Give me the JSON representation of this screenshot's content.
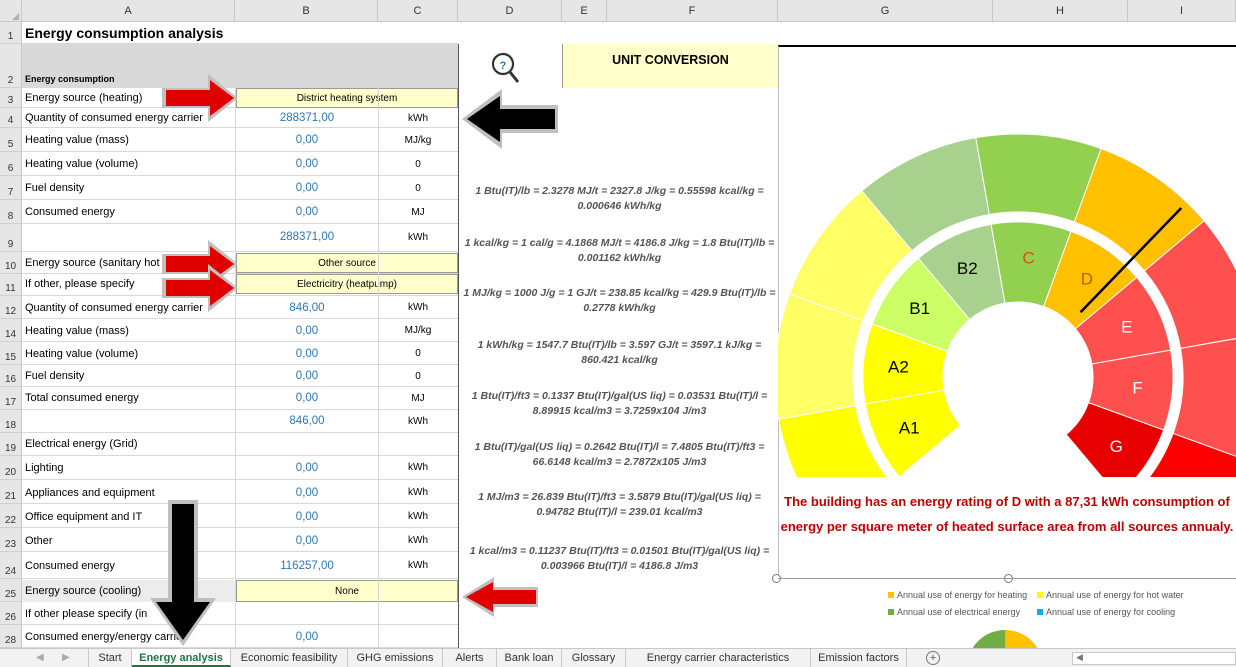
{
  "columns": [
    "A",
    "B",
    "C",
    "D",
    "E",
    "F",
    "G",
    "H",
    "I"
  ],
  "title": "Energy consumption analysis",
  "rows": {
    "r2": "Energy consumption",
    "r3": "Energy source (heating)",
    "r4": "Quantity of consumed energy carrier",
    "r5": "Heating value (mass)",
    "r6": "Heating value (volume)",
    "r7": "Fuel density",
    "r8": "Consumed energy",
    "r10": "Energy source (sanitary hot water)",
    "r11": "If other, please specify",
    "r12": "Quantity of consumed energy carrier",
    "r14": "Heating value (mass)",
    "r15": "Heating value (volume)",
    "r16": "Fuel density",
    "r17": "Total consumed energy",
    "r19": "Electrical energy (Grid)",
    "r20": "Lighting",
    "r21": "Appliances and equipment",
    "r22": "Office equipment and IT",
    "r23": "Other",
    "r24": "Consumed energy",
    "r25": "Energy source (cooling)",
    "r26": "If other please specify (in ",
    "r26b": ")",
    "r28": "Consumed energy/energy carrier"
  },
  "values": {
    "b3": "District heating system",
    "b4": "288371,00",
    "c4": "kWh",
    "b5": "0,00",
    "c5": "MJ/kg",
    "b6": "0,00",
    "c6": "0",
    "b7": "0,00",
    "c7": "0",
    "b8": "0,00",
    "c8": "MJ",
    "b9": "288371,00",
    "c9": "kWh",
    "b10": "Other source",
    "b11": "Electricitry (heatpump)",
    "b12": "846,00",
    "c12": "kWh",
    "b14": "0,00",
    "c14": "MJ/kg",
    "b15": "0,00",
    "c15": "0",
    "b16": "0,00",
    "c16": "0",
    "b17": "0,00",
    "c17": "MJ",
    "b18": "846,00",
    "c18": "kWh",
    "b20": "0,00",
    "c20": "kWh",
    "b21": "0,00",
    "c21": "kWh",
    "b22": "0,00",
    "c22": "kWh",
    "b23": "0,00",
    "c23": "kWh",
    "b24": "116257,00",
    "c24": "kWh",
    "b25": "None",
    "b28": "0,00"
  },
  "unit_conversion": {
    "heading": "UNIT CONVERSION",
    "lines": [
      "1 Btu(IT)/lb = 2.3278 MJ/t = 2327.8 J/kg = 0.55598 kcal/kg = 0.000646 kWh/kg",
      "1 kcal/kg = 1 cal/g = 4.1868 MJ/t = 4186.8 J/kg = 1.8 Btu(IT)/lb = 0.001162 kWh/kg",
      "1 MJ/kg = 1000 J/g = 1 GJ/t  = 238.85 kcal/kg = 429.9 Btu(IT)/lb = 0.2778 kWh/kg",
      "1 kWh/kg = 1547.7 Btu(IT)/lb = 3.597 GJ/t = 3597.1 kJ/kg = 860.421 kcal/kg",
      "1 Btu(IT)/ft3 = 0.1337 Btu(IT)/gal(US liq) = 0.03531 Btu(IT)/l = 8.89915 kcal/m3 = 3.7259x104 J/m3",
      "1 Btu(IT)/gal(US liq) = 0.2642 Btu(IT)/l = 7.4805 Btu(IT)/ft3 = 66.6148  kcal/m3 = 2.7872x105 J/m3",
      "1 MJ/m3 = 26.839 Btu(IT)/ft3 = 3.5879 Btu(IT)/gal(US liq) = 0.94782 Btu(IT)/l = 239.01 kcal/m3",
      "1 kcal/m3 = 0.11237 Btu(IT)/ft3 = 0.01501 Btu(IT)/gal(US liq) = 0.003966 Btu(IT)/l  = 4186.8 J/m3"
    ]
  },
  "gauge": {
    "labels": [
      "A1",
      "A2",
      "B1",
      "B2",
      "C",
      "D",
      "E",
      "F",
      "G"
    ],
    "current_class": "D",
    "colors": {
      "yellow": "#ffff00",
      "yellow_light": "#ffff66",
      "lime": "#ccff66",
      "green": "#92d050",
      "green_light": "#a9d18e",
      "orange": "#ffc000",
      "red_light": "#ff5050",
      "red": "#ff0000",
      "red_dark": "#e60000"
    }
  },
  "rating_text": "The building has an energy rating of D with a 87,31 kWh consumption of energy per square meter of heated surface area from all sources annualy.",
  "legend": [
    {
      "label": "Annual use of energy for heating",
      "color": "#ffc000"
    },
    {
      "label": "Annual use of energy for hot water",
      "color": "#ffff00"
    },
    {
      "label": "Annual use of electrical energy",
      "color": "#70ad47"
    },
    {
      "label": "Annual use of energy for cooling",
      "color": "#00b0f0"
    }
  ],
  "sheet_tabs": [
    "Start",
    "Energy analysis",
    "Economic feasibility",
    "GHG emissions",
    "Alerts",
    "Bank loan",
    "Glossary",
    "Energy carrier characteristics",
    "Emission factors"
  ],
  "active_tab": "Energy analysis",
  "add_sheet": "+"
}
